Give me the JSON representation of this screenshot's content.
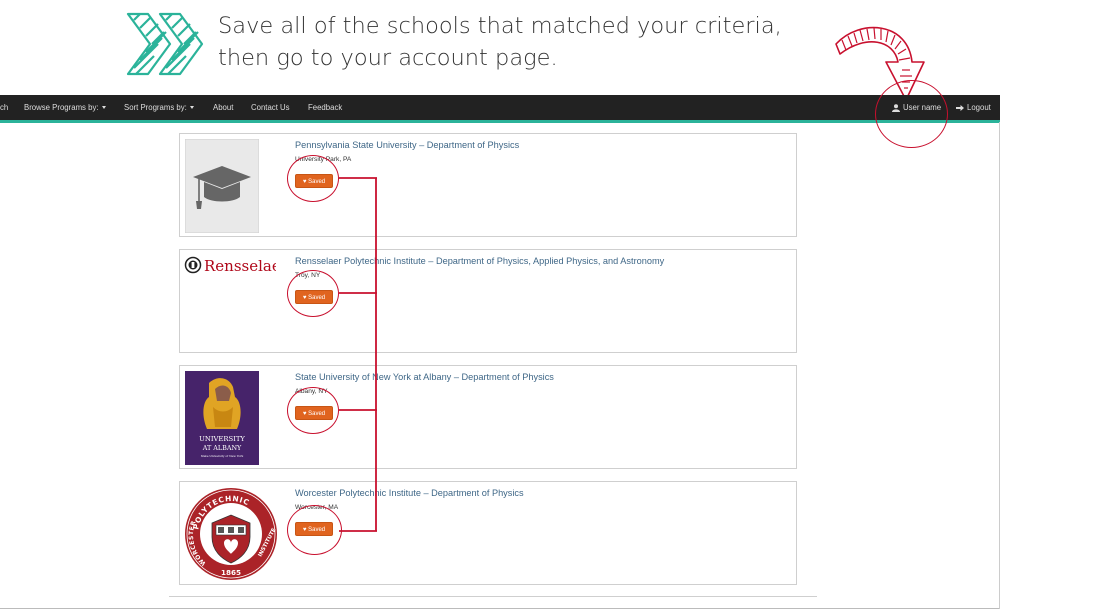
{
  "instruction": {
    "line1": "Save all of the schools that matched your criteria,",
    "line2": "then go to your account page."
  },
  "nav": {
    "search_partial": "ch",
    "browse": "Browse Programs by:",
    "sort": "Sort Programs by:",
    "about": "About",
    "contact": "Contact Us",
    "feedback": "Feedback",
    "user": "User name",
    "logout": "Logout"
  },
  "programs": [
    {
      "title": "Pennsylvania State University – Department of Physics",
      "location": "University Park, PA",
      "saved_label": "Saved",
      "thumb": "graduation-cap-placeholder"
    },
    {
      "title": "Rensselaer Polytechnic Institute – Department of Physics, Applied Physics, and Astronomy",
      "location": "Troy, NY",
      "saved_label": "Saved",
      "thumb": "rensselaer-logo",
      "logo_text": "Rensselaer"
    },
    {
      "title": "State University of New York at Albany – Department of Physics",
      "location": "Albany, NY",
      "saved_label": "Saved",
      "thumb": "ualbany-logo",
      "logo_text": "UNIVERSITY",
      "logo_text2": "AT ALBANY",
      "logo_text3": "State University of New York"
    },
    {
      "title": "Worcester Polytechnic Institute – Department of Physics",
      "location": "Worcester, MA",
      "saved_label": "Saved",
      "thumb": "wpi-seal",
      "logo_text": "POLYTECHNIC",
      "logo_text2": "WORCESTER",
      "logo_text3": "INSTITUTE",
      "logo_year": "1865"
    }
  ],
  "colors": {
    "navbar": "#222222",
    "accent": "#2bb39a",
    "saved": "#e0641f",
    "annotation": "#c8102e",
    "title_link": "#3f6787"
  }
}
